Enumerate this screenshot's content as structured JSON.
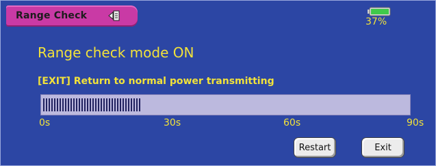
{
  "header": {
    "title": "Range Check",
    "back_icon": "back-arrow-icon"
  },
  "battery": {
    "icon": "battery-icon",
    "level": 0.37,
    "label": "37%",
    "color": "#3fc94a"
  },
  "status": {
    "mode": "Range check mode ON",
    "hint": "[EXIT] Return to normal power transmitting"
  },
  "progress": {
    "elapsed_fraction": 0.27,
    "ticks": [
      "0s",
      "30s",
      "60s",
      "90s"
    ]
  },
  "buttons": {
    "restart": "Restart",
    "exit": "Exit"
  },
  "colors": {
    "background": "#2c46a4",
    "title_tab": "#c93aa5",
    "text_accent": "#f2e23a",
    "progress_track": "#bcb9de",
    "progress_fill": "#20215e"
  }
}
